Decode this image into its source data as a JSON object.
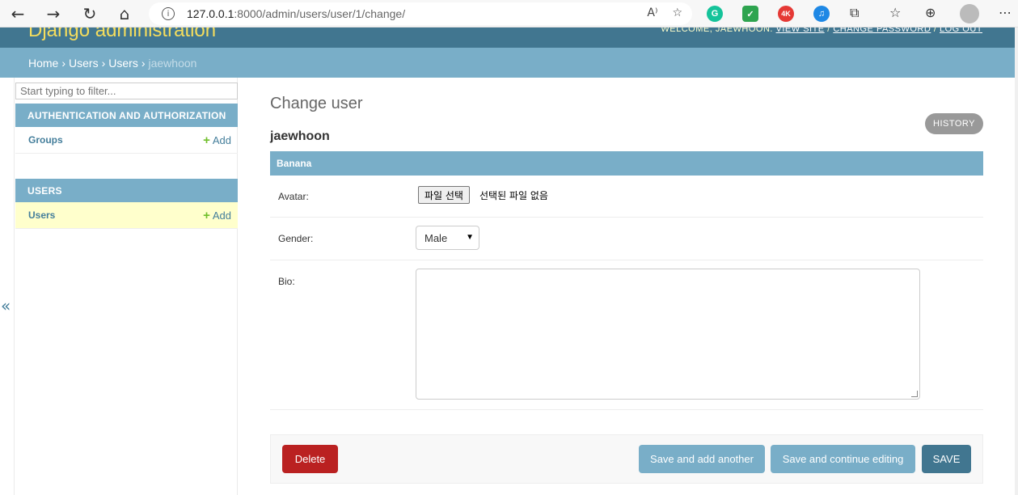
{
  "browser": {
    "url_host": "127.0.0.1",
    "url_path": ":8000/admin/users/user/1/change/"
  },
  "header": {
    "brand": "Django administration",
    "welcome": "WELCOME, JAEWHOON.",
    "view_site": "VIEW SITE",
    "change_password": "CHANGE PASSWORD",
    "log_out": "LOG OUT"
  },
  "breadcrumbs": [
    "Home",
    "Users",
    "Users",
    "jaewhoon"
  ],
  "sidebar": {
    "filter_placeholder": "Start typing to filter...",
    "modules": [
      {
        "caption": "AUTHENTICATION AND AUTHORIZATION",
        "models": [
          {
            "name": "Groups",
            "add": "Add"
          }
        ]
      },
      {
        "caption": "USERS",
        "models": [
          {
            "name": "Users",
            "add": "Add"
          }
        ]
      }
    ],
    "collapse": "«"
  },
  "main": {
    "title": "Change user",
    "object_name": "jaewhoon",
    "history": "HISTORY",
    "fieldset": "Banana",
    "fields": {
      "avatar_label": "Avatar:",
      "file_button": "파일 선택",
      "file_status": "선택된 파일 없음",
      "gender_label": "Gender:",
      "gender_value": "Male",
      "bio_label": "Bio:"
    },
    "actions": {
      "delete": "Delete",
      "save_add": "Save and add another",
      "save_continue": "Save and continue editing",
      "save": "SAVE"
    }
  },
  "colors": {
    "header_bg": "#417690",
    "breadcrumb_bg": "#79aec8",
    "brand": "#f5dd5d",
    "delete": "#ba2121",
    "add_plus": "#70bf2b"
  }
}
